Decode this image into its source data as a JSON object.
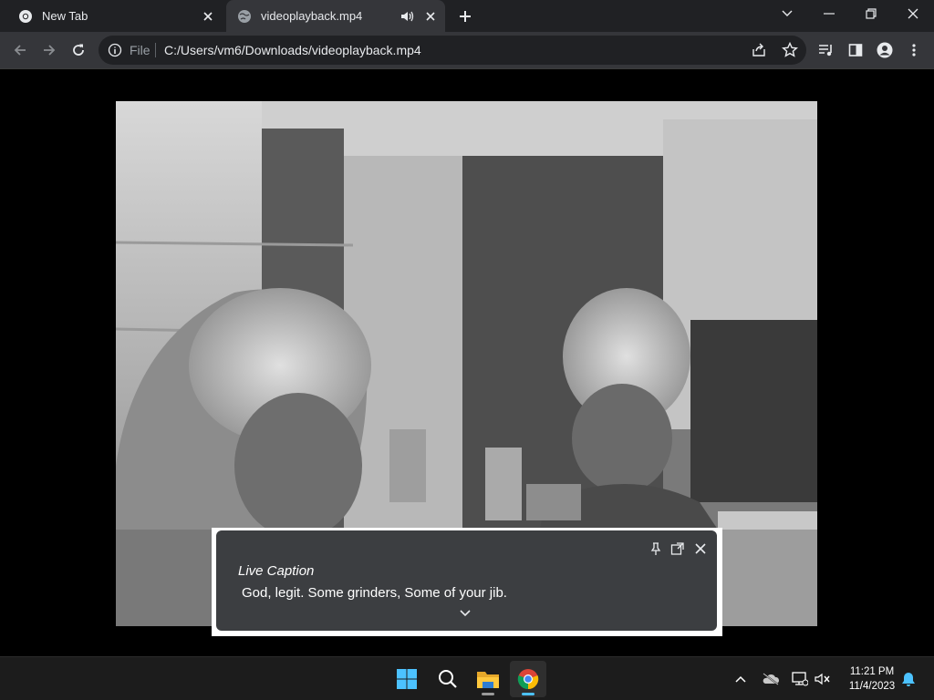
{
  "tabs": [
    {
      "title": "New Tab",
      "icon": "chrome-icon",
      "active": false
    },
    {
      "title": "videoplayback.mp4",
      "icon": "globe-icon",
      "active": true,
      "playing_audio": true
    }
  ],
  "toolbar": {
    "scheme_label": "File",
    "url": "C:/Users/vm6/Downloads/videoplayback.mp4"
  },
  "live_caption": {
    "title": "Live Caption",
    "text": "God, legit. Some grinders, Some of your jib."
  },
  "taskbar": {
    "apps": [
      "start-icon",
      "search-icon",
      "file-explorer-icon",
      "chrome-icon"
    ],
    "time": "11:21 PM",
    "date": "11/4/2023"
  },
  "colors": {
    "tabstrip": "#202124",
    "toolbar": "#35363a",
    "caption_bg": "#3c3e41",
    "taskbar": "#1c1c1c"
  }
}
